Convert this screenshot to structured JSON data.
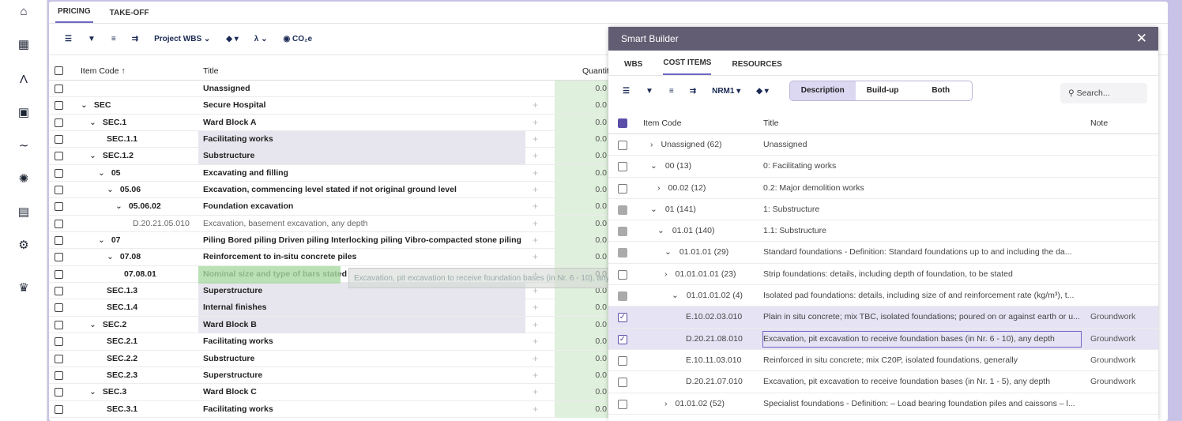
{
  "app": {
    "top_tabs": [
      "PRICING",
      "TAKE-OFF"
    ],
    "active_tab": "PRICING"
  },
  "toolbar": {
    "wbs_label": "Project WBS",
    "co2_label": "CO₂e"
  },
  "grid": {
    "headers": {
      "code": "Item Code",
      "title": "Title",
      "qty": "Quantit"
    },
    "rows": [
      {
        "code": "",
        "title": "Unassigned",
        "qty": "0.0",
        "indent": 0,
        "chev": "",
        "bold": true,
        "gray": false
      },
      {
        "code": "SEC",
        "title": "Secure Hospital",
        "qty": "0.0",
        "indent": 0,
        "chev": "v",
        "bold": true,
        "gray": false
      },
      {
        "code": "SEC.1",
        "title": "Ward Block A",
        "qty": "0.0",
        "indent": 1,
        "chev": "v",
        "bold": true,
        "gray": false
      },
      {
        "code": "SEC.1.1",
        "title": "Facilitating works",
        "qty": "0.0",
        "indent": 3,
        "chev": "",
        "bold": true,
        "gray": true
      },
      {
        "code": "SEC.1.2",
        "title": "Substructure",
        "qty": "0.0",
        "indent": 1,
        "chev": "v",
        "bold": true,
        "gray": true
      },
      {
        "code": "05",
        "title": "Excavating and filling",
        "qty": "0.0",
        "indent": 2,
        "chev": "v",
        "bold": true,
        "gray": false
      },
      {
        "code": "05.06",
        "title": "Excavation, commencing level stated if not original ground level",
        "qty": "0.0",
        "indent": 3,
        "chev": "v",
        "bold": true,
        "gray": false
      },
      {
        "code": "05.06.02",
        "title": "Foundation excavation",
        "qty": "0.0",
        "indent": 4,
        "chev": "v",
        "bold": true,
        "gray": false
      },
      {
        "code": "D.20.21.05.010",
        "title": "Excavation, basement excavation, any depth",
        "qty": "0.0",
        "indent": 6,
        "chev": "",
        "bold": false,
        "gray": false
      },
      {
        "code": "07",
        "title": "Piling Bored piling Driven piling Interlocking piling Vibro-compacted stone piling",
        "qty": "0.0",
        "indent": 2,
        "chev": "v",
        "bold": true,
        "gray": false
      },
      {
        "code": "07.08",
        "title": "Reinforcement to in-situ concrete piles",
        "qty": "0.0",
        "indent": 3,
        "chev": "v",
        "bold": true,
        "gray": false
      },
      {
        "code": "07.08.01",
        "title": "Nominal size and type of bars stated",
        "qty": "0.0",
        "indent": 5,
        "chev": "",
        "bold": true,
        "gray": false
      },
      {
        "code": "SEC.1.3",
        "title": "Superstructure",
        "qty": "0.0",
        "indent": 3,
        "chev": "",
        "bold": true,
        "gray": true
      },
      {
        "code": "SEC.1.4",
        "title": "Internal finishes",
        "qty": "0.0",
        "indent": 3,
        "chev": "",
        "bold": true,
        "gray": true
      },
      {
        "code": "SEC.2",
        "title": "Ward Block B",
        "qty": "0.0",
        "indent": 1,
        "chev": "v",
        "bold": true,
        "gray": true
      },
      {
        "code": "SEC.2.1",
        "title": "Facilitating works",
        "qty": "0.0",
        "indent": 3,
        "chev": "",
        "bold": true,
        "gray": false
      },
      {
        "code": "SEC.2.2",
        "title": "Substructure",
        "qty": "0.0",
        "indent": 3,
        "chev": "",
        "bold": true,
        "gray": false
      },
      {
        "code": "SEC.2.3",
        "title": "Superstructure",
        "qty": "0.0",
        "indent": 3,
        "chev": "",
        "bold": true,
        "gray": false
      },
      {
        "code": "SEC.3",
        "title": "Ward Block C",
        "qty": "0.0",
        "indent": 1,
        "chev": "v",
        "bold": true,
        "gray": false
      },
      {
        "code": "SEC.3.1",
        "title": "Facilitating works",
        "qty": "0.0",
        "indent": 3,
        "chev": "",
        "bold": true,
        "gray": false
      }
    ],
    "drag_ghost": "Excavation, pit excavation to receive foundation bases (in Nr. 6 - 10), any depth"
  },
  "smart_builder": {
    "title": "Smart Builder",
    "tabs": [
      "WBS",
      "COST ITEMS",
      "RESOURCES"
    ],
    "active_tab": "COST ITEMS",
    "nrm_label": "NRM1",
    "seg": [
      "Description",
      "Build-up",
      "Both"
    ],
    "seg_active": "Description",
    "search_placeholder": "Search...",
    "headers": {
      "code": "Item Code",
      "title": "Title",
      "note": "Note"
    },
    "rows": [
      {
        "code": "Unassigned (62)",
        "chev": ">",
        "indent": 1,
        "title": "Unassigned",
        "note": "",
        "cb": "empty",
        "sel": false
      },
      {
        "code": "00 (13)",
        "chev": "v",
        "indent": 1,
        "title": "0: Facilitating works",
        "note": "",
        "cb": "empty",
        "sel": false
      },
      {
        "code": "00.02 (12)",
        "chev": ">",
        "indent": 2,
        "title": "0.2: Major demolition works",
        "note": "",
        "cb": "empty",
        "sel": false
      },
      {
        "code": "01 (141)",
        "chev": "v",
        "indent": 1,
        "title": "1: Substructure",
        "note": "",
        "cb": "dash",
        "sel": false
      },
      {
        "code": "01.01 (140)",
        "chev": "v",
        "indent": 2,
        "title": "1.1: Substructure",
        "note": "",
        "cb": "dash",
        "sel": false
      },
      {
        "code": "01.01.01 (29)",
        "chev": "v",
        "indent": 3,
        "title": "Standard foundations - Definition: Standard foundations up to and including the da...",
        "note": "",
        "cb": "dash",
        "sel": false
      },
      {
        "code": "01.01.01.01 (23)",
        "chev": ">",
        "indent": 3,
        "title": "Strip foundations: details, including depth of foundation, to be stated",
        "note": "",
        "cb": "empty",
        "sel": false
      },
      {
        "code": "01.01.01.02 (4)",
        "chev": "v",
        "indent": 4,
        "title": "Isolated pad foundations: details, including size of and reinforcement rate (kg/m³), t...",
        "note": "",
        "cb": "dash",
        "sel": false
      },
      {
        "code": "E.10.02.03.010",
        "chev": "",
        "indent": 6,
        "title": "Plain in situ concrete; mix TBC, isolated foundations; poured on or against earth or u...",
        "note": "Groundwork",
        "cb": "chk",
        "sel": true
      },
      {
        "code": "D.20.21.08.010",
        "chev": "",
        "indent": 6,
        "title": "Excavation, pit excavation to receive foundation bases (in Nr. 6 - 10), any depth",
        "note": "Groundwork",
        "cb": "chk",
        "sel": true
      },
      {
        "code": "E.10.11.03.010",
        "chev": "",
        "indent": 6,
        "title": "Reinforced in situ concrete; mix C20P, isolated foundations, generally",
        "note": "Groundwork",
        "cb": "empty",
        "sel": false
      },
      {
        "code": "D.20.21.07.010",
        "chev": "",
        "indent": 6,
        "title": "Excavation, pit excavation to receive foundation bases (in Nr. 1 - 5), any depth",
        "note": "Groundwork",
        "cb": "empty",
        "sel": false
      },
      {
        "code": "01.01.02 (52)",
        "chev": ">",
        "indent": 3,
        "title": "Specialist foundations - Definition: – Load bearing foundation piles and caissons – l...",
        "note": "",
        "cb": "empty",
        "sel": false
      }
    ]
  }
}
